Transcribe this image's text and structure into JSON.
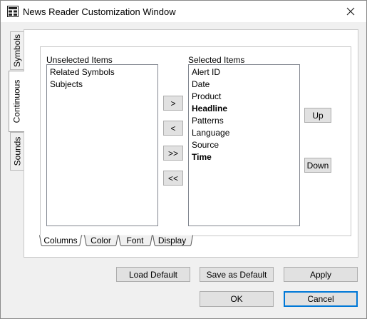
{
  "window": {
    "title": "News Reader Customization Window",
    "app_icon": "window-grid-icon",
    "close_icon": "close-icon"
  },
  "side_tabs": [
    {
      "label": "Symbols",
      "active": false
    },
    {
      "label": "Continuous",
      "active": true
    },
    {
      "label": "Sounds",
      "active": false
    }
  ],
  "unselected": {
    "label": "Unselected Items",
    "items": [
      {
        "text": "Related Symbols",
        "bold": false
      },
      {
        "text": "Subjects",
        "bold": false
      }
    ]
  },
  "selected": {
    "label": "Selected Items",
    "items": [
      {
        "text": "Alert ID",
        "bold": false
      },
      {
        "text": "Date",
        "bold": false
      },
      {
        "text": "Product",
        "bold": false
      },
      {
        "text": "Headline",
        "bold": true
      },
      {
        "text": "Patterns",
        "bold": false
      },
      {
        "text": "Language",
        "bold": false
      },
      {
        "text": "Source",
        "bold": false
      },
      {
        "text": "Time",
        "bold": true
      }
    ]
  },
  "move_buttons": {
    "add": ">",
    "remove": "<",
    "add_all": ">>",
    "remove_all": "<<"
  },
  "order_buttons": {
    "up": "Up",
    "down": "Down"
  },
  "bottom_tabs": [
    {
      "label": "Columns",
      "active": true
    },
    {
      "label": "Color",
      "active": false
    },
    {
      "label": "Font",
      "active": false
    },
    {
      "label": "Display",
      "active": false
    }
  ],
  "actions": {
    "load_default": "Load Default",
    "save_default": "Save as Default",
    "apply": "Apply",
    "ok": "OK",
    "cancel": "Cancel"
  },
  "colors": {
    "focus_border": "#0078d7",
    "button_face": "#e1e1e1",
    "window_bg": "#f0f0f0"
  }
}
